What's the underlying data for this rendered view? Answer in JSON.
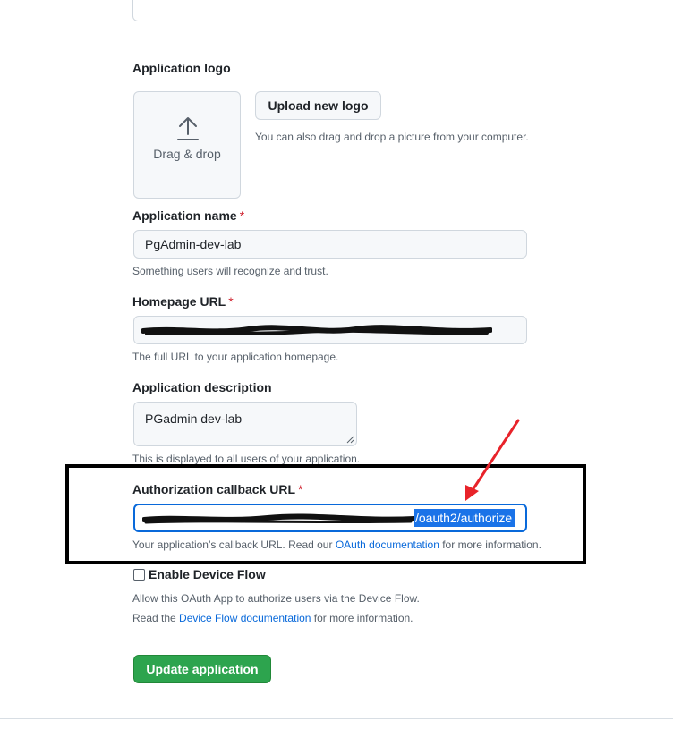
{
  "logo": {
    "label": "Application logo",
    "drop_text": "Drag & drop",
    "upload_button": "Upload new logo",
    "hint": "You can also drag and drop a picture from your computer."
  },
  "app_name": {
    "label": "Application name",
    "required_mark": "*",
    "value": "PgAdmin-dev-lab",
    "hint": "Something users will recognize and trust."
  },
  "homepage": {
    "label": "Homepage URL",
    "required_mark": "*",
    "hint": "The full URL to your application homepage."
  },
  "description": {
    "label": "Application description",
    "value": "PGadmin dev-lab",
    "hint": "This is displayed to all users of your application."
  },
  "callback": {
    "label": "Authorization callback URL",
    "required_mark": "*",
    "selected_value": "/oauth2/authorize",
    "hint_prefix": "Your application’s callback URL. Read our ",
    "hint_link": "OAuth documentation",
    "hint_suffix": " for more information."
  },
  "device_flow": {
    "label": "Enable Device Flow",
    "checked": false,
    "hint": "Allow this OAuth App to authorize users via the Device Flow.",
    "doc_prefix": "Read the ",
    "doc_link": "Device Flow documentation",
    "doc_suffix": " for more information."
  },
  "actions": {
    "update_button": "Update application"
  },
  "colors": {
    "primary": "#2da44e",
    "link": "#0969da",
    "required": "#cf222e",
    "annotation_arrow": "#e8232a",
    "annotation_box": "#000000",
    "selection": "#1a73e8"
  }
}
